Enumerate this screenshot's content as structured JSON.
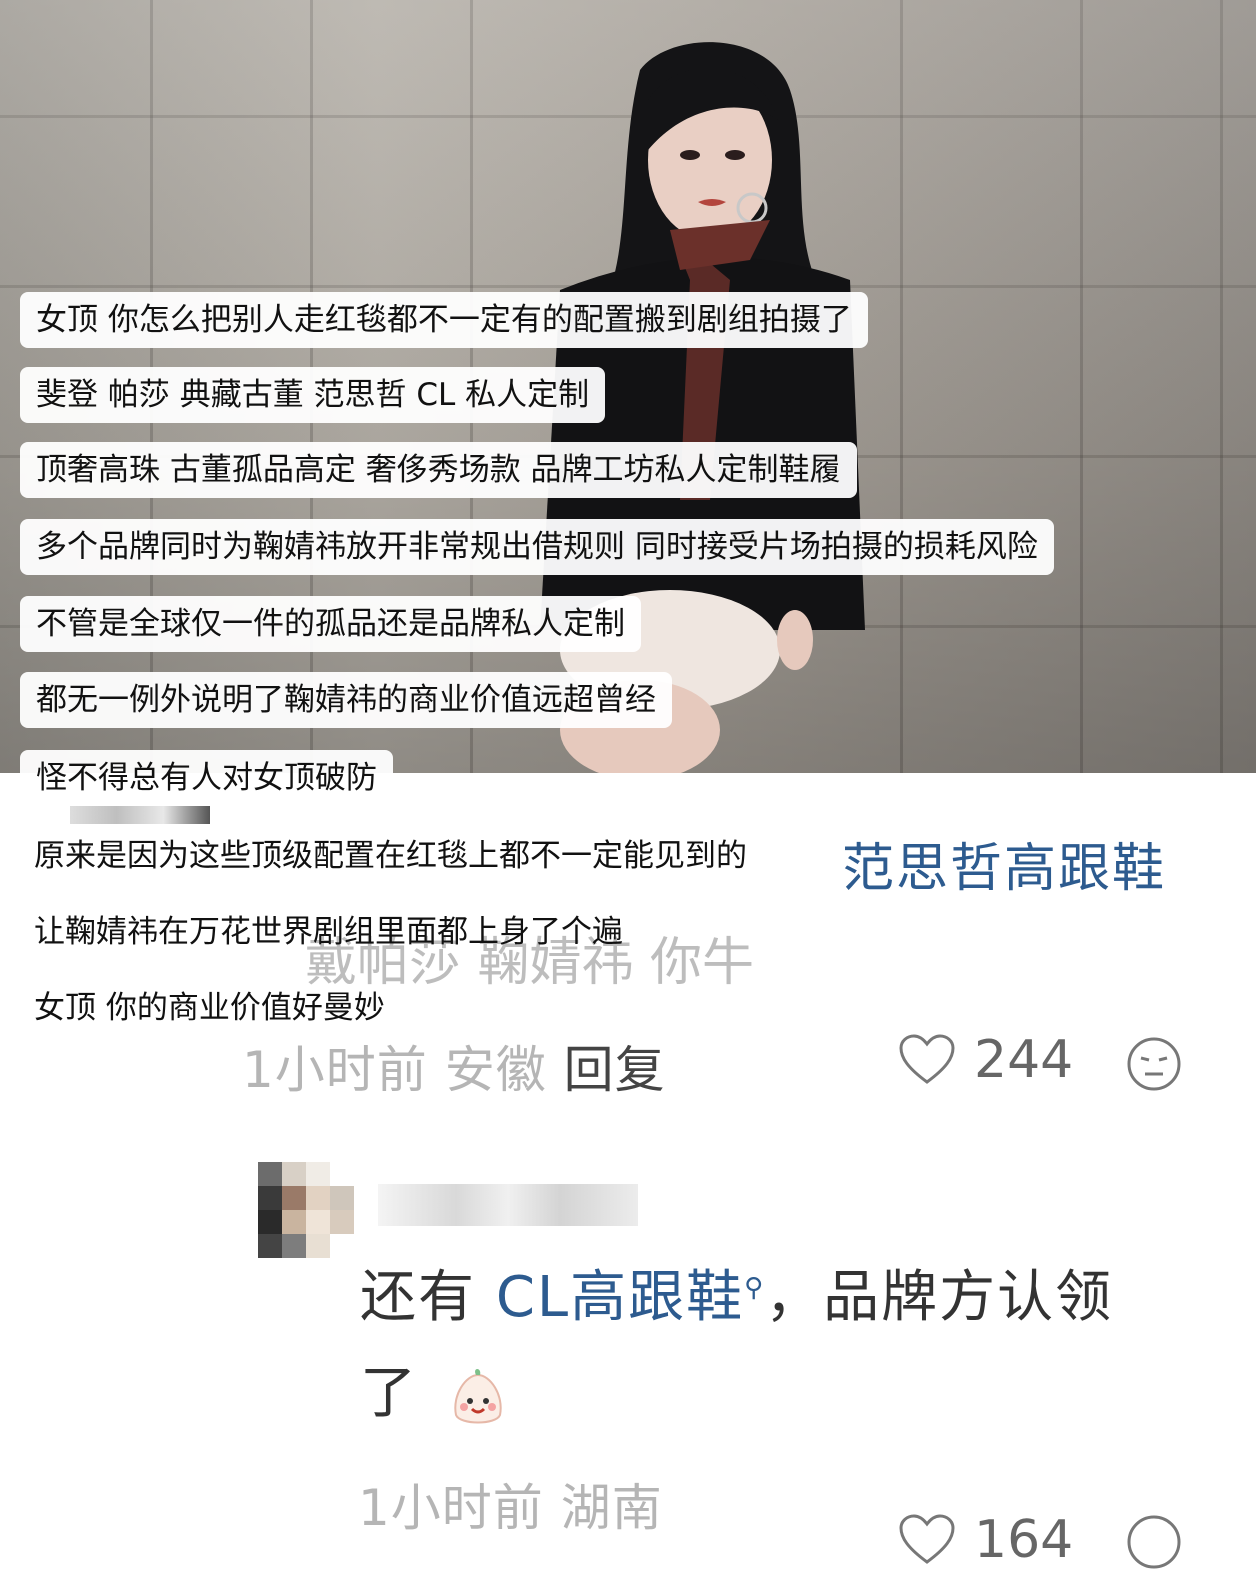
{
  "overlay_lines": [
    "女顶 你怎么把别人走红毯都不一定有的配置搬到剧组拍摄了",
    "斐登 帕莎 典藏古董 范思哲 CL 私人定制",
    "顶奢高珠 古董孤品高定 奢侈秀场款 品牌工坊私人定制鞋履",
    "多个品牌同时为鞠婧祎放开非常规出借规则 同时接受片场拍摄的损耗风险",
    "不管是全球仅一件的孤品还是品牌私人定制",
    "都无一例外说明了鞠婧祎的商业价值远超曾经",
    "怪不得总有人对女顶破防",
    "原来是因为这些顶级配置在红毯上都不一定能见到的",
    "让鞠婧祎在万花世界剧组里面都上身了个遍",
    "女顶 你的商业价值好曼妙"
  ],
  "comment1": {
    "highlight": "范思哲高跟鞋",
    "ghost_text": "戴帕莎 鞠婧祎 你牛",
    "time": "1小时前",
    "location": "安徽",
    "reply_label": "回复",
    "likes": "244"
  },
  "comment2": {
    "prefix": "还有 ",
    "link": "CL高跟鞋",
    "suffix": "，品牌方认领",
    "suffix2": "了",
    "time": "1小时前",
    "location": "湖南",
    "likes": "164"
  },
  "colors": {
    "link": "#2d5b8f",
    "meta": "#b5b5b5"
  }
}
